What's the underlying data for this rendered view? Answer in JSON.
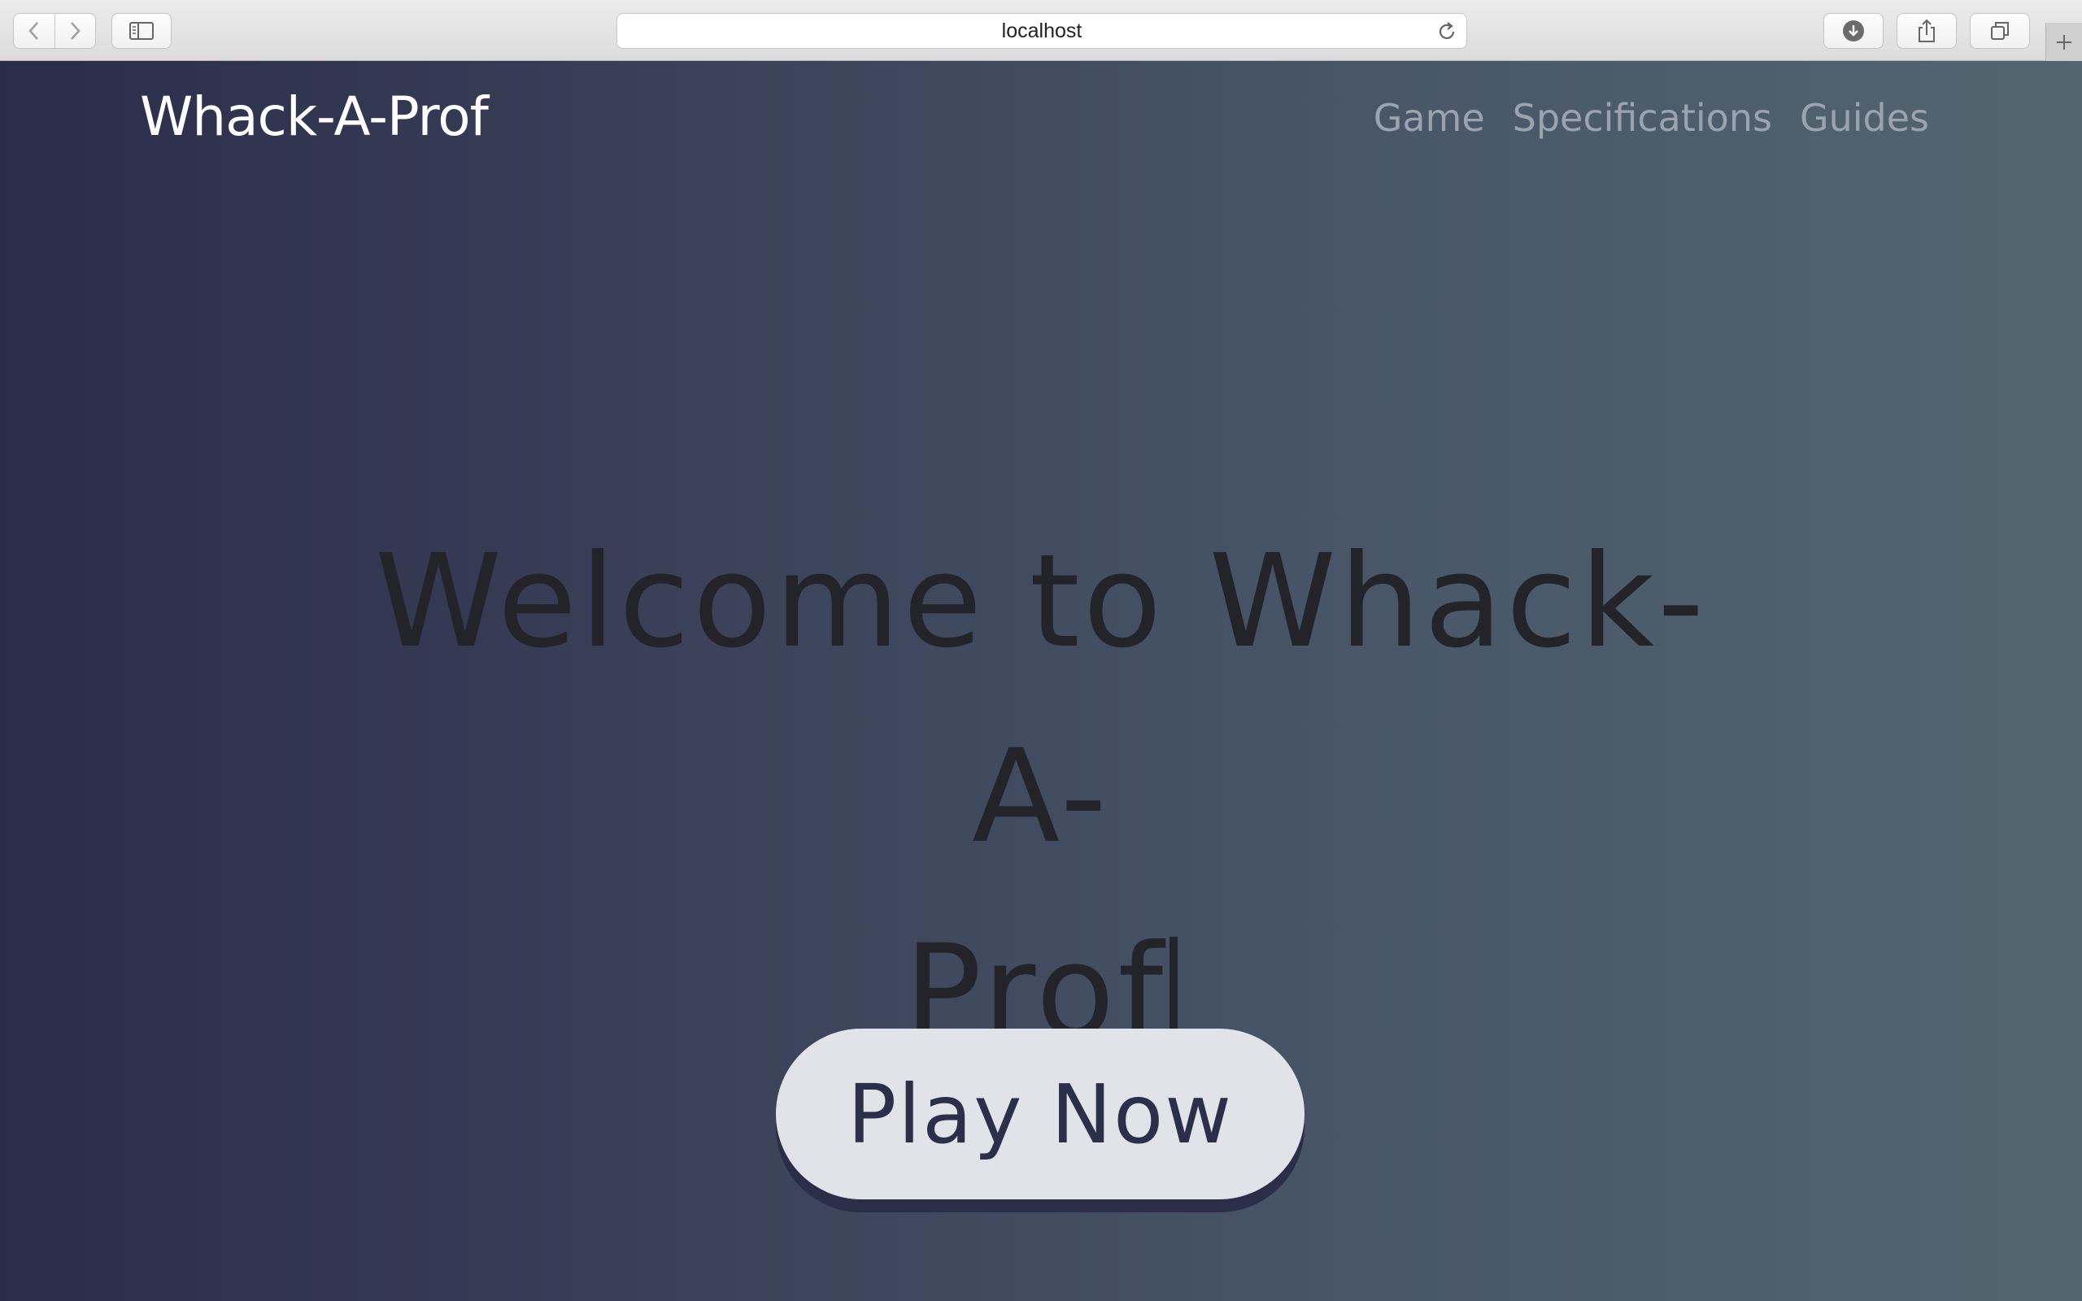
{
  "browser": {
    "address": "localhost",
    "icons": {
      "back": "chevron-left-icon",
      "forward": "chevron-right-icon",
      "sidebar": "sidebar-icon",
      "reload": "reload-icon",
      "downloads": "download-icon",
      "share": "share-icon",
      "tabs": "tabs-icon",
      "new_tab": "plus-icon"
    }
  },
  "site": {
    "brand": "Whack-A-Prof",
    "nav": [
      {
        "label": "Game"
      },
      {
        "label": "Specifications"
      },
      {
        "label": "Guides"
      }
    ]
  },
  "hero": {
    "headline_line1": "Welcome to Whack-A-",
    "headline_line2": "Prof",
    "cta_label": "Play Now"
  },
  "colors": {
    "gradient_start": "#2a2d4a",
    "gradient_end": "#54656f",
    "brand_text": "#ffffff",
    "nav_text": "#9aa3ae",
    "headline_text": "#222429",
    "button_bg": "#e1e3e8",
    "button_text": "#2b2f49"
  }
}
